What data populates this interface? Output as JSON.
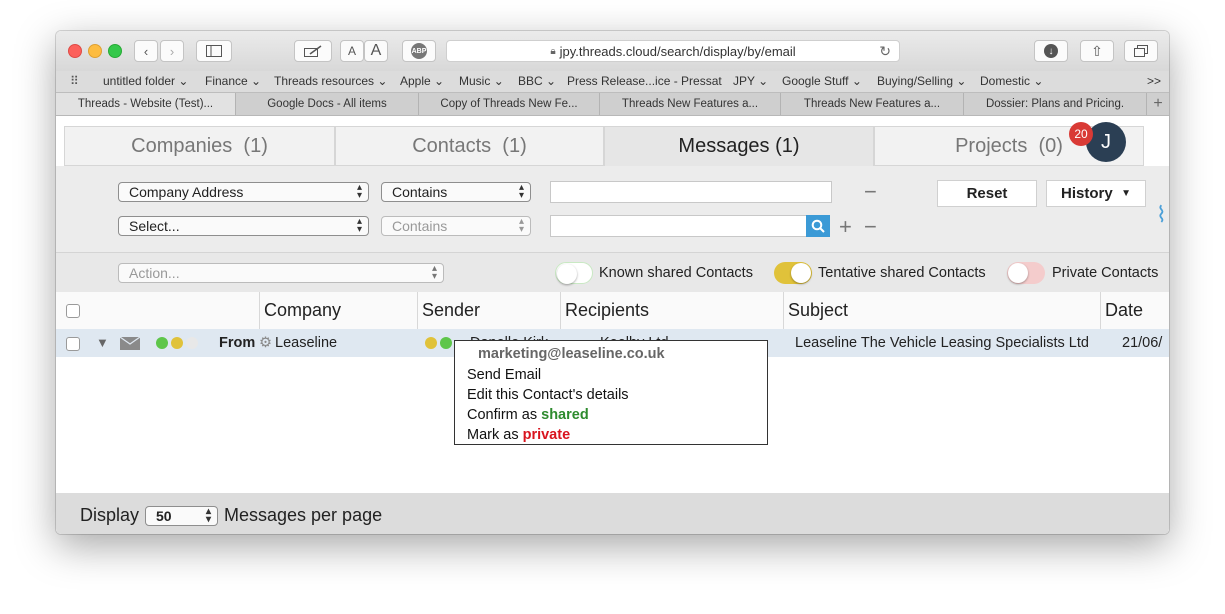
{
  "browser": {
    "url": "jpy.threads.cloud/search/display/by/email",
    "font_small": "A",
    "font_large": "A",
    "abp": "ABP",
    "bookmarks": [
      "untitled folder",
      "Finance",
      "Threads resources",
      "Apple",
      "Music",
      "BBC",
      "Press Release...ice - Pressat",
      "JPY",
      "Google Stuff",
      "Buying/Selling",
      "Domestic"
    ],
    "bookmark_overflow": ">>",
    "tabs": [
      "Threads - Website (Test)...",
      "Google Docs - All items",
      "Copy of Threads New Fe...",
      "Threads New Features a...",
      "Threads New Features a...",
      "Dossier: Plans and Pricing."
    ],
    "new_tab": "+"
  },
  "app": {
    "tabs": [
      {
        "label": "Companies",
        "count": "(1)"
      },
      {
        "label": "Contacts",
        "count": "(1)"
      },
      {
        "label": "Messages",
        "count": "(1)"
      },
      {
        "label": "Projects",
        "count": "(0)"
      }
    ],
    "notification_count": "20",
    "avatar_initial": "J"
  },
  "filters": {
    "field1": "Company Address",
    "op1": "Contains",
    "field2": "Select...",
    "op2": "Contains",
    "minus": "−",
    "plus": "+",
    "reset": "Reset",
    "history": "History",
    "history_arrow": "▼"
  },
  "actionbar": {
    "action_placeholder": "Action...",
    "toggles": [
      {
        "label": "Known shared Contacts",
        "on": false
      },
      {
        "label": "Tentative shared Contacts",
        "on": true
      },
      {
        "label": "Private Contacts",
        "on": false
      }
    ]
  },
  "table": {
    "headers": [
      "Company",
      "Sender",
      "Recipients",
      "Subject",
      "Date"
    ],
    "row": {
      "direction": "From",
      "company": "Leaseline",
      "sender": "Danelle Kirk",
      "recipients": "Keelby Ltd",
      "subject": "Leaseline The Vehicle Leasing Specialists Ltd",
      "date": "21/06/"
    }
  },
  "popup": {
    "email": "marketing@leaseline.co.uk",
    "send": "Send Email",
    "edit": "Edit this Contact's details",
    "confirm_prefix": "Confirm as ",
    "confirm_word": "shared",
    "mark_prefix": "Mark as ",
    "mark_word": "private"
  },
  "footer": {
    "display": "Display",
    "per_page": "50",
    "suffix": "Messages per page"
  },
  "colors": {
    "accent_blue": "#3b9ad6",
    "shared_green": "#2e8b2e",
    "private_red": "#d9141e",
    "toggle_on": "#e0c23a",
    "toggle_known": "#b8e6b0",
    "toggle_private": "#f0b6b6"
  }
}
